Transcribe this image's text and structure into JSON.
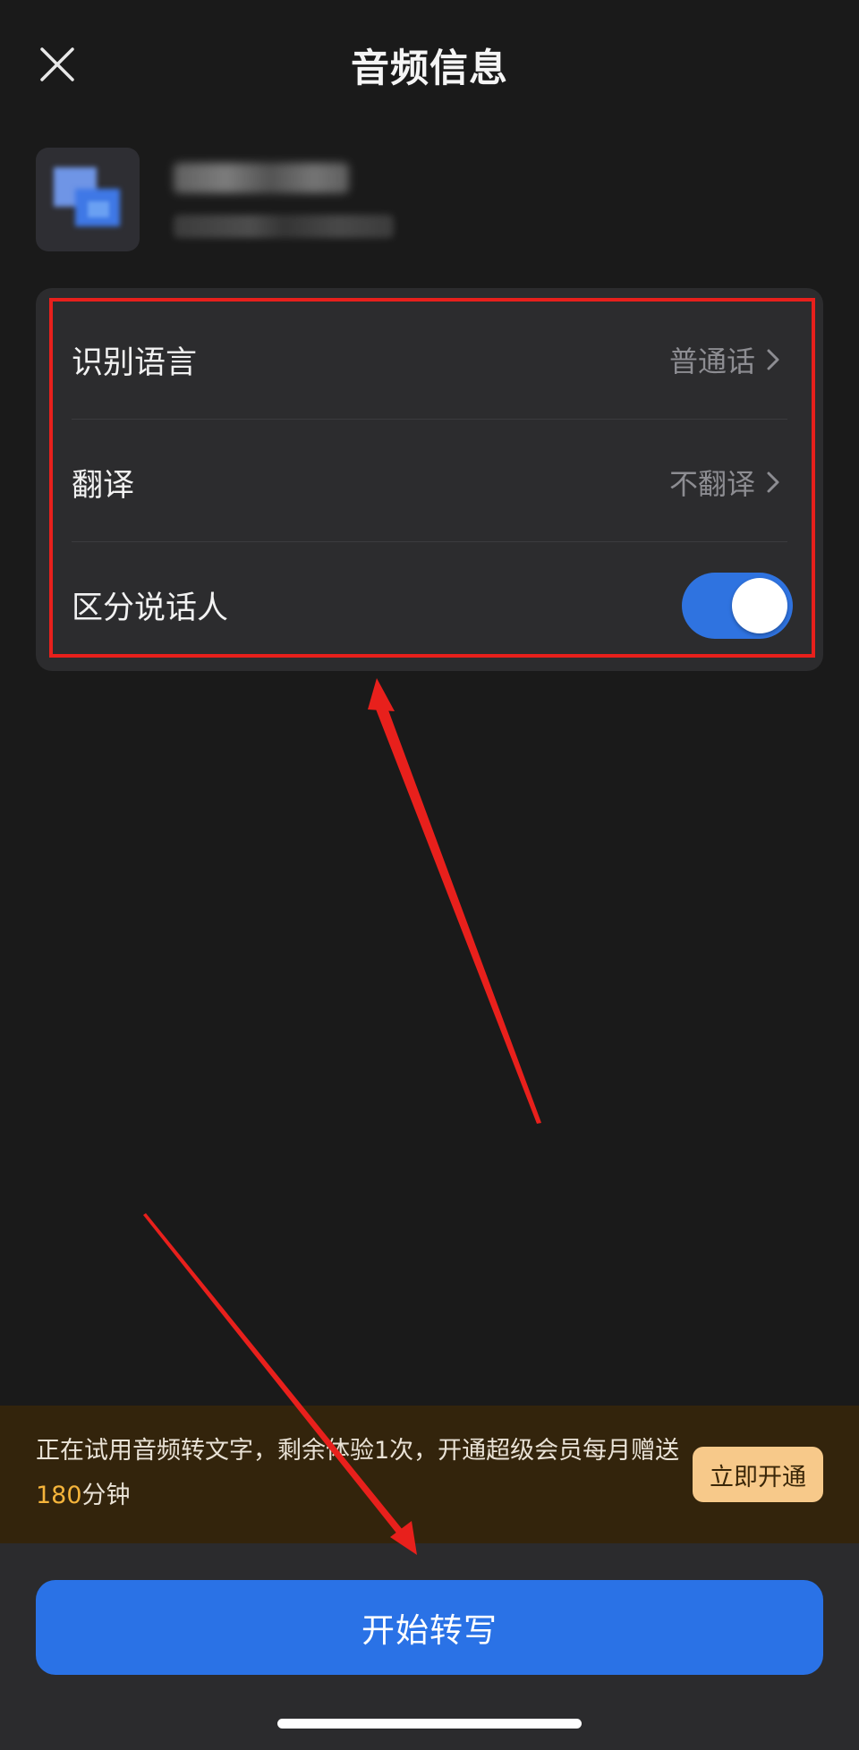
{
  "header": {
    "title": "音频信息",
    "close_icon": "close-icon"
  },
  "settings": {
    "items": [
      {
        "label": "识别语言",
        "value": "普通话",
        "icon": "chevron-right-icon"
      },
      {
        "label": "翻译",
        "value": "不翻译",
        "icon": "chevron-right-icon"
      },
      {
        "label": "区分说话人",
        "toggle_on": true
      }
    ]
  },
  "trial_banner": {
    "text_before": "正在试用音频转文字，剩余体验1次，开通超级会员每月赠送",
    "highlight": "180",
    "text_after": "分钟",
    "button_label": "立即开通"
  },
  "primary_action": {
    "label": "开始转写"
  },
  "colors": {
    "accent_blue": "#2a72e6",
    "highlight_orange": "#f5b43b",
    "annotation_red": "#e8201c",
    "banner_bg": "#33240c"
  }
}
